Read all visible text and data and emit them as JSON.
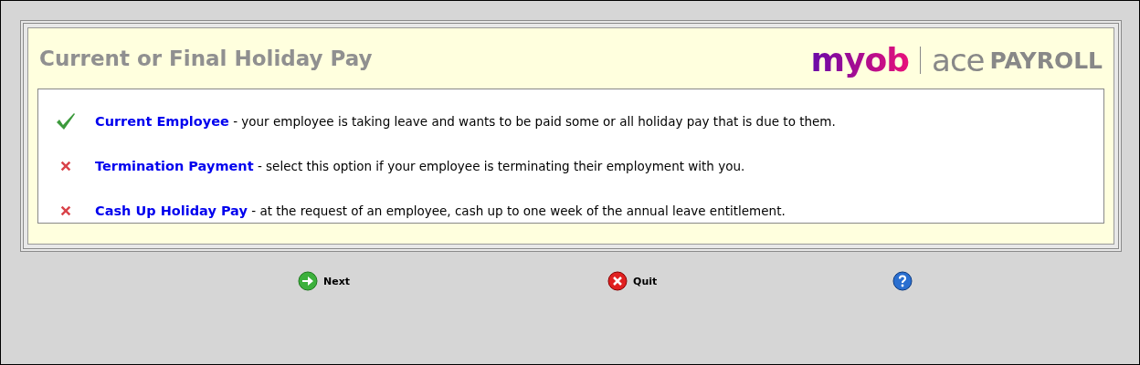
{
  "title": "Current or Final Holiday Pay",
  "logo": {
    "brand": "myob",
    "product": "ace",
    "product_suffix": "PAYROLL"
  },
  "options": [
    {
      "kind": "check",
      "label": "Current Employee",
      "description": " - your employee is taking leave and wants to be paid some or all holiday pay that is due to them."
    },
    {
      "kind": "cross",
      "label": "Termination Payment",
      "description": " - select this option if your employee is terminating their employment with you."
    },
    {
      "kind": "cross",
      "label": "Cash Up Holiday Pay",
      "description": " - at the request of an employee, cash up to one week of the annual leave entitlement."
    }
  ],
  "buttons": [
    {
      "kind": "next",
      "label": "Next"
    },
    {
      "kind": "quit",
      "label": "Quit"
    },
    {
      "kind": "help"
    }
  ]
}
